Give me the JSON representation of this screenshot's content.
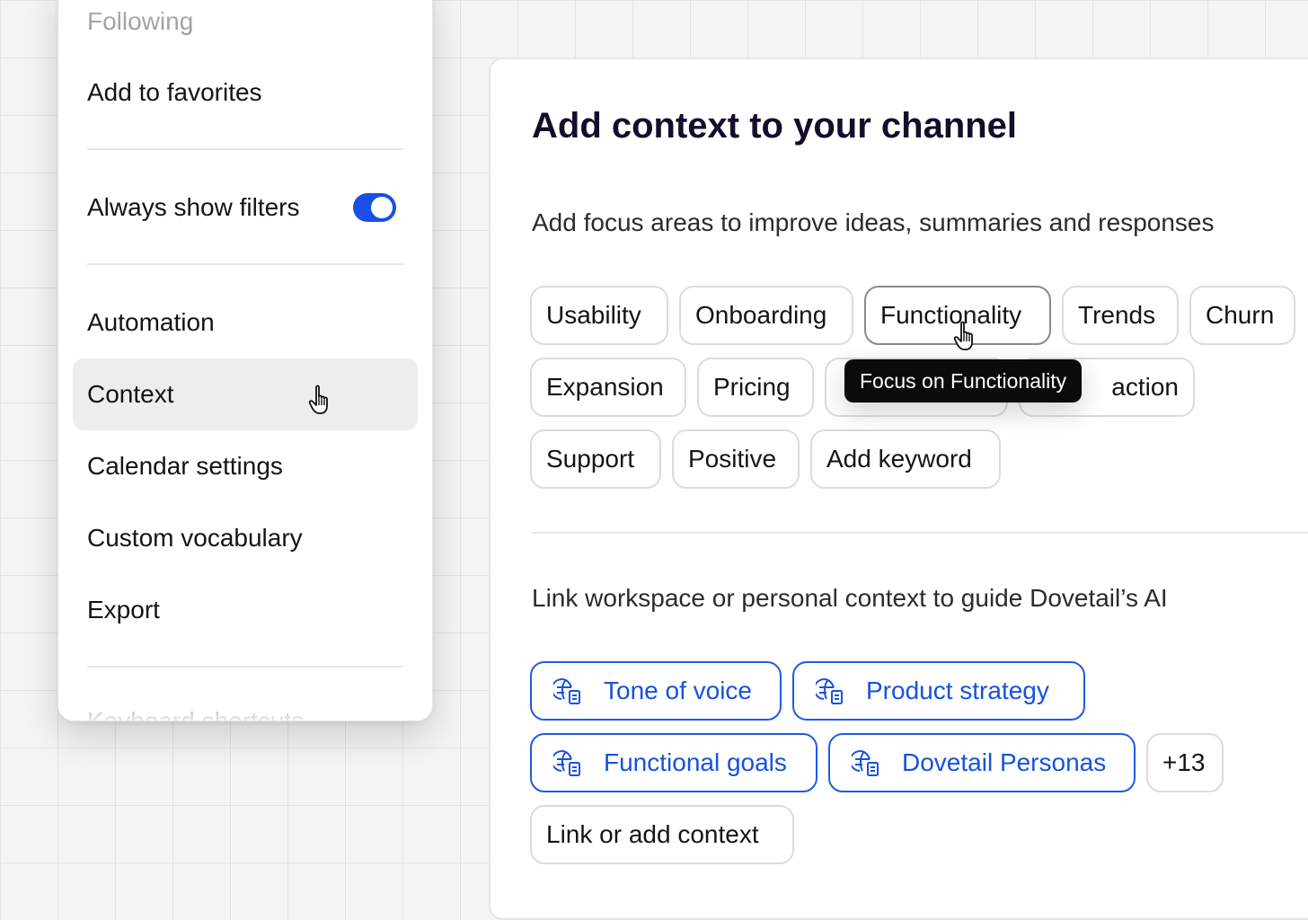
{
  "menu": {
    "items": [
      {
        "label": "Following"
      },
      {
        "label": "Add to favorites"
      },
      {
        "label": "Always show filters",
        "toggle_on": true
      },
      {
        "label": "Automation"
      },
      {
        "label": "Context",
        "selected": true
      },
      {
        "label": "Calendar settings"
      },
      {
        "label": "Custom vocabulary"
      },
      {
        "label": "Export"
      },
      {
        "label": "Keyboard shortcuts"
      }
    ]
  },
  "panel": {
    "title": "Add context to your channel",
    "focus_subtitle": "Add focus areas to improve ideas, summaries and responses",
    "focus_chips": [
      {
        "label": "Usability"
      },
      {
        "label": "Onboarding"
      },
      {
        "label": "Functionality",
        "hovered": true
      },
      {
        "label": "Trends"
      },
      {
        "label": "Churn"
      },
      {
        "label": "Expansion"
      },
      {
        "label": "Pricing"
      },
      {
        "label": ""
      },
      {
        "label": "action"
      },
      {
        "label": "Support"
      },
      {
        "label": "Positive"
      },
      {
        "label": "Add keyword"
      }
    ],
    "tooltip": "Focus on Functionality",
    "link_subtitle": "Link workspace or personal context to guide Dovetail’s AI",
    "context_chips": [
      {
        "label": "Tone of voice",
        "icon": "globe-doc-icon"
      },
      {
        "label": "Product strategy",
        "icon": "globe-doc-icon"
      },
      {
        "label": "Functional goals",
        "icon": "globe-doc-icon"
      },
      {
        "label": "Dovetail Personas",
        "icon": "globe-doc-icon"
      }
    ],
    "more_count": "+13",
    "add_context_label": "Link or add context"
  },
  "colors": {
    "accent": "#1a4fe6",
    "link_text": "#1652e0",
    "title": "#150d2a",
    "selected_bg": "#ededed",
    "tooltip_bg": "#0b0b0b"
  }
}
